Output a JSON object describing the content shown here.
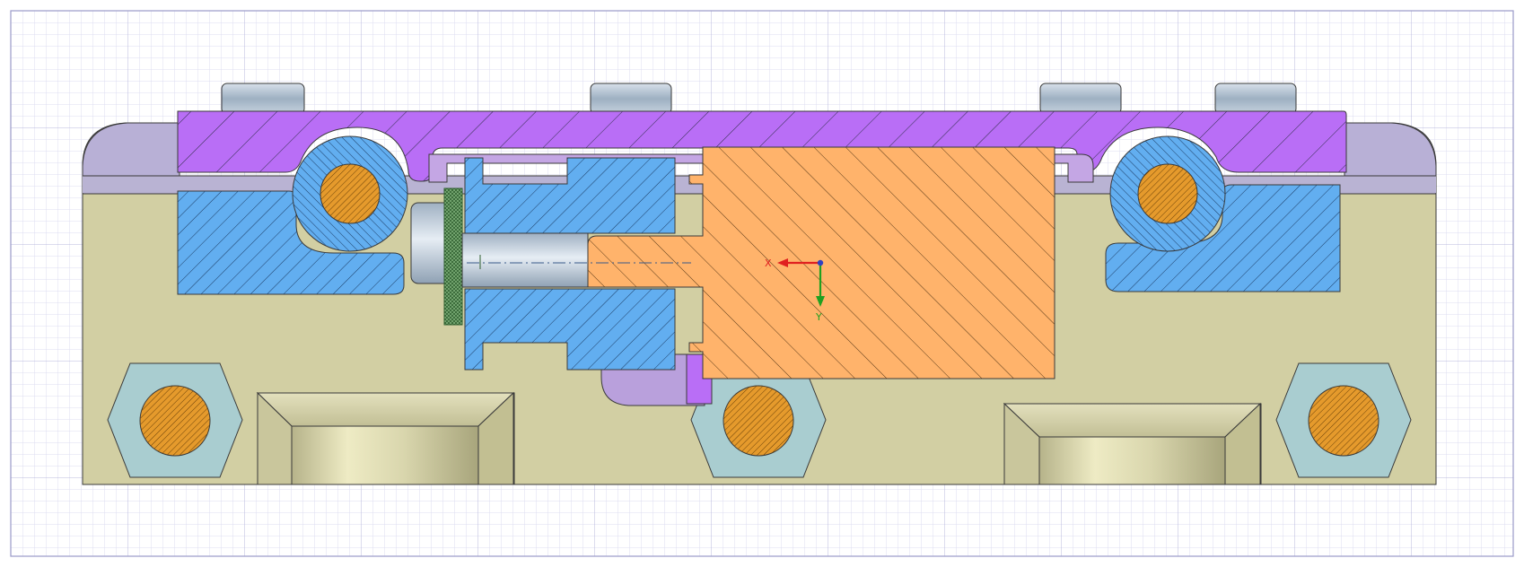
{
  "app": {
    "view": "section-view"
  },
  "triad": {
    "x_label": "X",
    "y_label": "Y"
  },
  "colors": {
    "background": "#ffffff",
    "grid_minor": "#dcdcf0",
    "grid_major": "#b8b8dc",
    "border": "#9a9ac8",
    "base_body": "#d2cfa3",
    "base_top_strip": "#b8b3cf",
    "clamp_plate": "#b96ef6",
    "clamp_plate_lower": "#b9a0dc",
    "blue_part": "#62aef0",
    "orange_block": "#ffb36b",
    "pin_orange": "#e59a2c",
    "hex_nut": "#a9cdd0",
    "bolt_head": "#b5c4d2",
    "shaft_grey": "#b9c5d2",
    "knurl_green": "#7fb07a",
    "outline": "#2a2a2a",
    "axis_x": "#e02020",
    "axis_y": "#20a020",
    "axis_origin": "#3040c0"
  },
  "icons": {
    "triad": "coordinate-triad-icon"
  }
}
